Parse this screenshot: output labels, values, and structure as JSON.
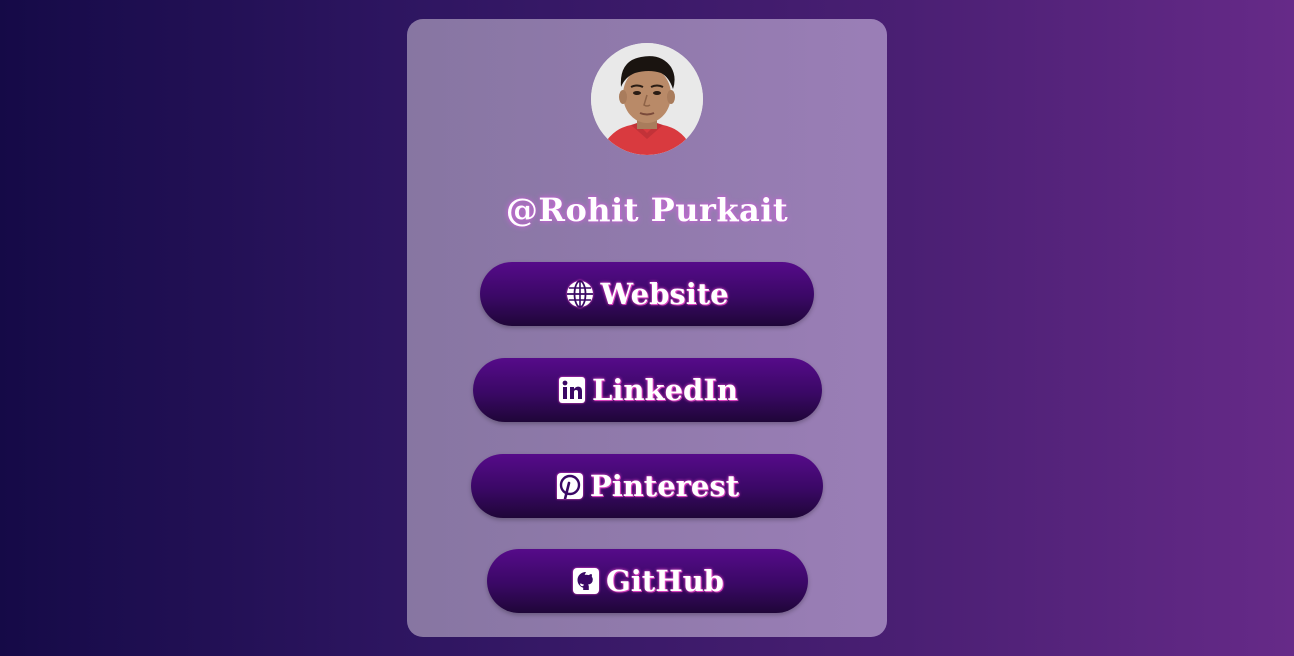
{
  "profile": {
    "handle": "@Rohit Purkait",
    "avatar_alt": "Rohit Purkait"
  },
  "links": {
    "website": {
      "label": "Website",
      "icon": "globe-icon"
    },
    "linkedin": {
      "label": "LinkedIn",
      "icon": "linkedin-icon"
    },
    "pinterest": {
      "label": "Pinterest",
      "icon": "pinterest-icon"
    },
    "github": {
      "label": "GitHub",
      "icon": "github-icon"
    }
  },
  "colors": {
    "background_start": "#150a47",
    "background_end": "#662a88",
    "button": "#4a0a78",
    "text_glow": "#d56be0"
  }
}
